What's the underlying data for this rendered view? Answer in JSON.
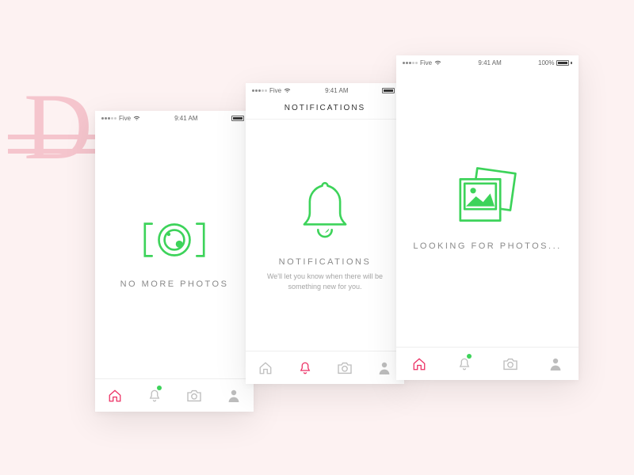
{
  "colors": {
    "accent_green": "#3dd35a",
    "accent_pink": "#ec2f63",
    "bg": "#fdf2f2"
  },
  "status": {
    "carrier": "Five",
    "time": "9:41 AM",
    "battery_pct": "100%"
  },
  "screens": {
    "feed_empty": {
      "title": "NO MORE PHOTOS"
    },
    "notifications": {
      "nav_title": "NOTIFICATIONS",
      "title": "NOTIFICATIONS",
      "subtitle": "We'll let you know when there will be something new for you."
    },
    "looking": {
      "title": "LOOKING FOR PHOTOS..."
    }
  },
  "tabs": [
    "home",
    "notifications",
    "camera",
    "profile"
  ]
}
